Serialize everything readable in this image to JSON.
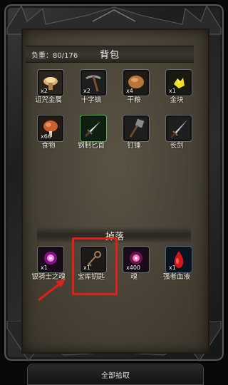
{
  "inventory": {
    "title": "背包",
    "weight": "负重：80/176",
    "items": [
      {
        "name": "诅咒金属",
        "qty": "x2",
        "icon": "metal-icon"
      },
      {
        "name": "十字镐",
        "qty": "x2",
        "icon": "pickaxe-icon"
      },
      {
        "name": "干粮",
        "qty": "x4",
        "icon": "bread-icon"
      },
      {
        "name": "金块",
        "qty": "x1",
        "icon": "gold-nugget-icon"
      },
      {
        "name": "食物",
        "qty": "x66",
        "icon": "meat-icon"
      },
      {
        "name": "钢制匕首",
        "qty": "",
        "icon": "dagger-icon"
      },
      {
        "name": "钉锤",
        "qty": "",
        "icon": "mace-icon"
      },
      {
        "name": "长剑",
        "qty": "",
        "icon": "longsword-icon"
      }
    ]
  },
  "drops": {
    "title": "掉落",
    "items": [
      {
        "name": "银骑士之魂",
        "qty": "x1",
        "icon": "pink-soul-icon"
      },
      {
        "name": "宝库钥匙",
        "qty": "x1",
        "icon": "key-icon"
      },
      {
        "name": "魂",
        "qty": "x400",
        "icon": "soul-icon"
      },
      {
        "name": "强者血液",
        "qty": "x1",
        "icon": "blood-drop-icon"
      }
    ]
  },
  "actions": {
    "pickup_all": "全部拾取"
  },
  "colors": {
    "highlight": "#e0201a",
    "panel": "#4a4438",
    "frame": "#2c2c2c"
  }
}
